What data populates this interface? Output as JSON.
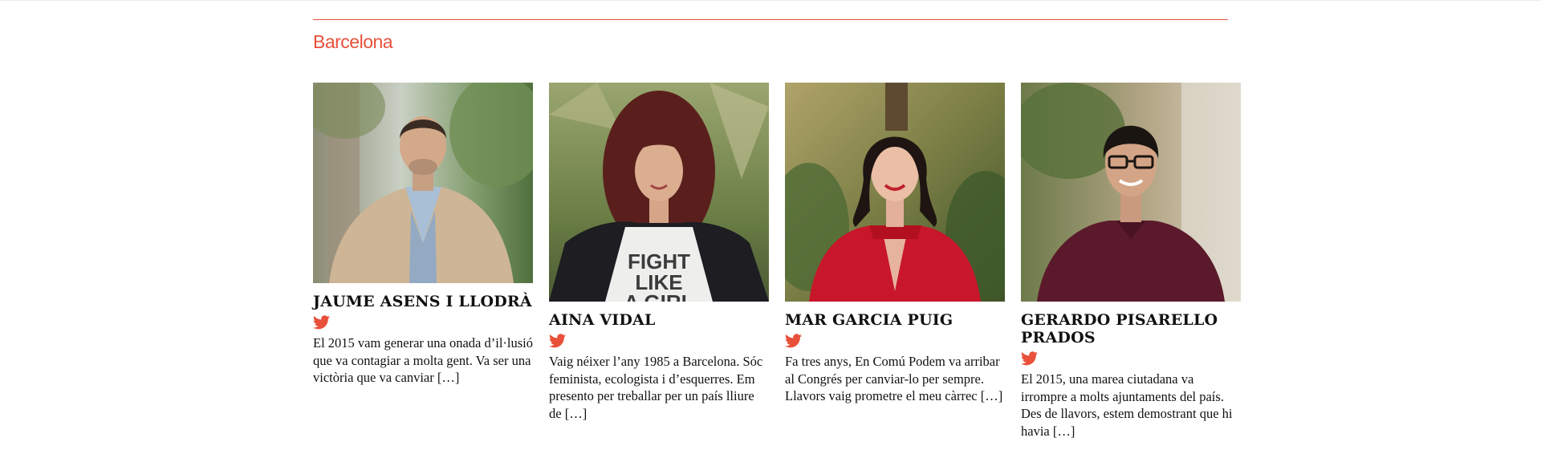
{
  "section": {
    "title": "Barcelona"
  },
  "accent_color": "#e8503a",
  "candidates": [
    {
      "name": "JAUME ASENS I LLODRÀ",
      "social_icon": "twitter-icon",
      "bio": "El 2015 vam generar una onada d’il·lusió que va contagiar a molta gent. Va ser una victòria que va canviar",
      "more": "[…]"
    },
    {
      "name": "AINA VIDAL",
      "social_icon": "twitter-icon",
      "bio": "Vaig néixer l’any 1985 a Barcelona. Sóc feminista, ecologista i d’esquerres. Em presento per treballar per un país lliure de",
      "more": "[…]",
      "shirt_text": [
        "FIGHT",
        "LIKE",
        "A GIRL"
      ]
    },
    {
      "name": "MAR GARCIA PUIG",
      "social_icon": "twitter-icon",
      "bio": "Fa tres anys, En Comú Podem va arribar al Congrés per canviar-lo per sempre. Llavors vaig prometre el meu càrrec",
      "more": "[…]"
    },
    {
      "name": "GERARDO PISARELLO PRADOS",
      "social_icon": "twitter-icon",
      "bio": "El 2015, una marea ciutadana va irrompre a molts ajuntaments del país. Des de llavors, estem demostrant que hi havia",
      "more": "[…]"
    }
  ]
}
